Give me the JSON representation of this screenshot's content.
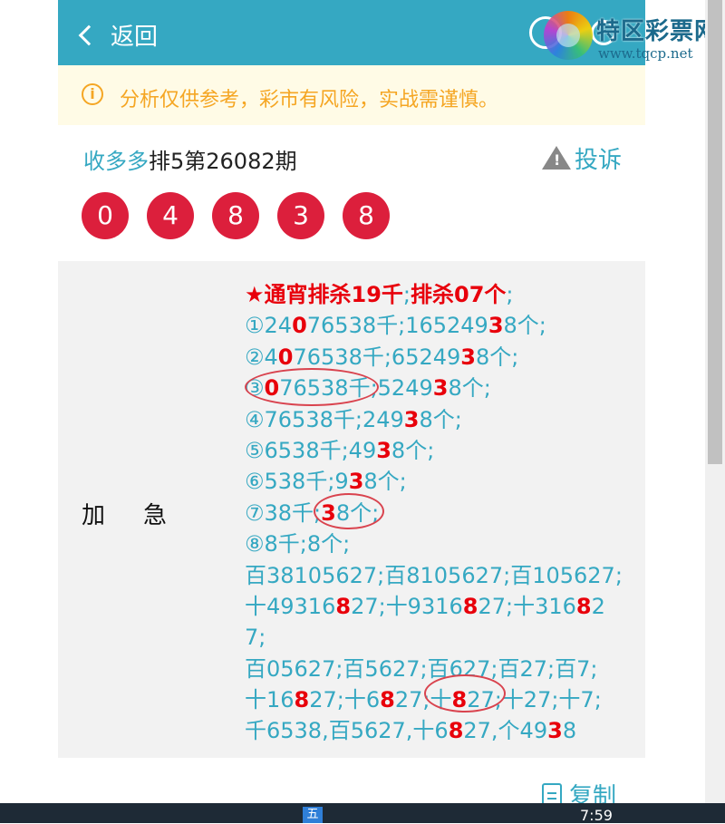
{
  "header": {
    "back_label": "返回"
  },
  "watermark": {
    "name": "特区彩票网",
    "url": "www.tqcp.net"
  },
  "notice": {
    "text": "分析仅供参考，彩市有风险，实战需谨慎。",
    "color": "#f5a623"
  },
  "issue": {
    "source": "收多多",
    "title": "排5第26082期"
  },
  "complain_label": "投诉",
  "balls": [
    "0",
    "4",
    "8",
    "3",
    "8"
  ],
  "panel": {
    "label_a": "加",
    "label_b": "急",
    "lines": [
      [
        {
          "t": "★通宵排杀19千",
          "s": "hr"
        },
        {
          "t": ";",
          "s": "n"
        },
        {
          "t": "排杀07个",
          "s": "hr"
        },
        {
          "t": ";",
          "s": "n"
        }
      ],
      [
        {
          "t": "①24",
          "s": "n"
        },
        {
          "t": "0",
          "s": "r"
        },
        {
          "t": "76538千;165249",
          "s": "n"
        },
        {
          "t": "3",
          "s": "r"
        },
        {
          "t": "8个;",
          "s": "n"
        }
      ],
      [
        {
          "t": "②4",
          "s": "n"
        },
        {
          "t": "0",
          "s": "r"
        },
        {
          "t": "76538千;65249",
          "s": "n"
        },
        {
          "t": "3",
          "s": "r"
        },
        {
          "t": "8个;",
          "s": "n"
        }
      ],
      [
        {
          "t": "③",
          "s": "n"
        },
        {
          "t": "0",
          "s": "r"
        },
        {
          "t": "76538千;5249",
          "s": "n"
        },
        {
          "t": "3",
          "s": "r"
        },
        {
          "t": "8个;",
          "s": "n"
        }
      ],
      [
        {
          "t": "④76538千;249",
          "s": "n"
        },
        {
          "t": "3",
          "s": "r"
        },
        {
          "t": "8个;",
          "s": "n"
        }
      ],
      [
        {
          "t": "⑤6538千;49",
          "s": "n"
        },
        {
          "t": "3",
          "s": "r"
        },
        {
          "t": "8个;",
          "s": "n"
        }
      ],
      [
        {
          "t": "⑥538千;9",
          "s": "n"
        },
        {
          "t": "3",
          "s": "r"
        },
        {
          "t": "8个;",
          "s": "n"
        }
      ],
      [
        {
          "t": "⑦38千;",
          "s": "n"
        },
        {
          "t": "3",
          "s": "r"
        },
        {
          "t": "8个;",
          "s": "n"
        }
      ],
      [
        {
          "t": "⑧8千;8个;",
          "s": "n"
        }
      ],
      [
        {
          "t": "百38105627;百8105627;百105627;",
          "s": "n"
        }
      ],
      [
        {
          "t": "十49316",
          "s": "n"
        },
        {
          "t": "8",
          "s": "r"
        },
        {
          "t": "27;十9316",
          "s": "n"
        },
        {
          "t": "8",
          "s": "r"
        },
        {
          "t": "27;十316",
          "s": "n"
        },
        {
          "t": "8",
          "s": "r"
        },
        {
          "t": "2",
          "s": "n"
        }
      ],
      [
        {
          "t": "7;",
          "s": "n"
        }
      ],
      [
        {
          "t": "百05627;百5627;百627;百27;百7;",
          "s": "n"
        }
      ],
      [
        {
          "t": "十16",
          "s": "n"
        },
        {
          "t": "8",
          "s": "r"
        },
        {
          "t": "27;十6",
          "s": "n"
        },
        {
          "t": "8",
          "s": "r"
        },
        {
          "t": "27;十",
          "s": "n"
        },
        {
          "t": "8",
          "s": "r"
        },
        {
          "t": "27;十27;十7;",
          "s": "n"
        }
      ],
      [
        {
          "t": "千6538,百5627,十6",
          "s": "n"
        },
        {
          "t": "8",
          "s": "r"
        },
        {
          "t": "27,个49",
          "s": "n"
        },
        {
          "t": "3",
          "s": "r"
        },
        {
          "t": "8",
          "s": "n"
        }
      ]
    ]
  },
  "copy_label": "复制",
  "taskbar": {
    "app_glyph": "五",
    "clock": "7:59"
  },
  "colors": {
    "accent": "#35a8c2",
    "ball": "#dc1f3c",
    "highlight": "#e8000b"
  }
}
